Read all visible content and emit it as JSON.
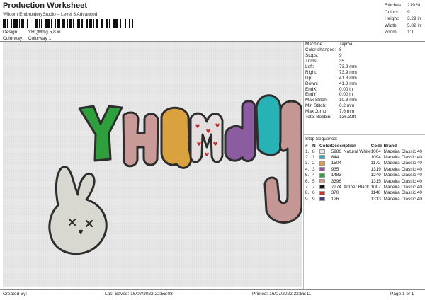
{
  "header": {
    "title": "Production Worksheet",
    "subtitle": "Wilcom EmbroideryStudio – Level 3 Advanced",
    "design_label": "Design:",
    "design_value": "YHQMdlg 5,8 in",
    "colorway_label": "Colorway:",
    "colorway_value": "Colorway 1"
  },
  "top_stats": [
    {
      "label": "Stitches:",
      "value": "21920"
    },
    {
      "label": "Colors:",
      "value": "9"
    },
    {
      "label": "Height:",
      "value": "3.29 in"
    },
    {
      "label": "Width:",
      "value": "5.82 in"
    },
    {
      "label": "Zoom:",
      "value": "1:1"
    }
  ],
  "machine_info": [
    {
      "label": "Machine:",
      "value": "Tajima"
    },
    {
      "label": "Color changes:",
      "value": "8"
    },
    {
      "label": "Stops:",
      "value": "9"
    },
    {
      "label": "Trims:",
      "value": "35"
    },
    {
      "label": "Left:",
      "value": "73.9 mm"
    },
    {
      "label": "Right:",
      "value": "73.9 mm"
    },
    {
      "label": "Up:",
      "value": "41.8 mm"
    },
    {
      "label": "Down:",
      "value": "41.8 mm"
    },
    {
      "label": "EndX:",
      "value": "0.00 in"
    },
    {
      "label": "EndY:",
      "value": "0.00 in"
    },
    {
      "label": "Max Stitch:",
      "value": "10.3 mm"
    },
    {
      "label": "Min Stitch:",
      "value": "0.2 mm"
    },
    {
      "label": "Max Jump:",
      "value": "7.6 mm"
    },
    {
      "label": "Total Bobbin:",
      "value": "136.39ft"
    }
  ],
  "stop_sequence": {
    "title": "Stop Sequence:",
    "columns": [
      "#",
      "N",
      "Color",
      "Description",
      "Code",
      "Brand"
    ],
    "rows": [
      {
        "num": "1.",
        "n": "8",
        "color": "#e6e6e6",
        "code_color": "5986",
        "description": "Natural White",
        "code": "1004",
        "brand": "Madeira Classic 40"
      },
      {
        "num": "2.",
        "n": "1",
        "color": "#1fb5b8",
        "code_color": "844",
        "description": "",
        "code": "1094",
        "brand": "Madeira Classic 40"
      },
      {
        "num": "3.",
        "n": "2",
        "color": "#dca13a",
        "code_color": "1504",
        "description": "",
        "code": "1172",
        "brand": "Madeira Classic 40"
      },
      {
        "num": "4.",
        "n": "3",
        "color": "#8e5aa0",
        "code_color": "935",
        "description": "",
        "code": "1319",
        "brand": "Madeira Classic 40"
      },
      {
        "num": "5.",
        "n": "4",
        "color": "#2da33a",
        "code_color": "1483",
        "description": "",
        "code": "1249",
        "brand": "Madeira Classic 40"
      },
      {
        "num": "6.",
        "n": "5",
        "color": "#d99a98",
        "code_color": "3396",
        "description": "",
        "code": "1315",
        "brand": "Madeira Classic 40"
      },
      {
        "num": "7.",
        "n": "7",
        "color": "#151515",
        "code_color": "7274",
        "description": "Amber Black",
        "code": "1007",
        "brand": "Madeira Classic 40"
      },
      {
        "num": "8.",
        "n": "6",
        "color": "#c9322e",
        "code_color": "370",
        "description": "",
        "code": "1146",
        "brand": "Madeira Classic 40"
      },
      {
        "num": "9.",
        "n": "9",
        "color": "#4a3b7c",
        "code_color": "126",
        "description": "",
        "code": "1313",
        "brand": "Madeira Classic 40"
      }
    ]
  },
  "design_preview": {
    "text": "YHQMdlg",
    "colors": {
      "y": "#2e9f3c",
      "h": "#c99a98",
      "q": "#d9a23f",
      "m": "#e4dede",
      "d": "#8b5c9f",
      "l": "#27b3b6",
      "g": "#c49694",
      "outline": "#2d2d2d",
      "bunny": "#d8d8d0",
      "hearts": "#c92b2b"
    }
  },
  "footer": {
    "created_by_label": "Created By:",
    "last_saved": "Last Saved: 16/07/2022 22:55:08",
    "printed": "Printed: 16/07/2022 22:55:11",
    "page": "Page 1 of 1"
  }
}
